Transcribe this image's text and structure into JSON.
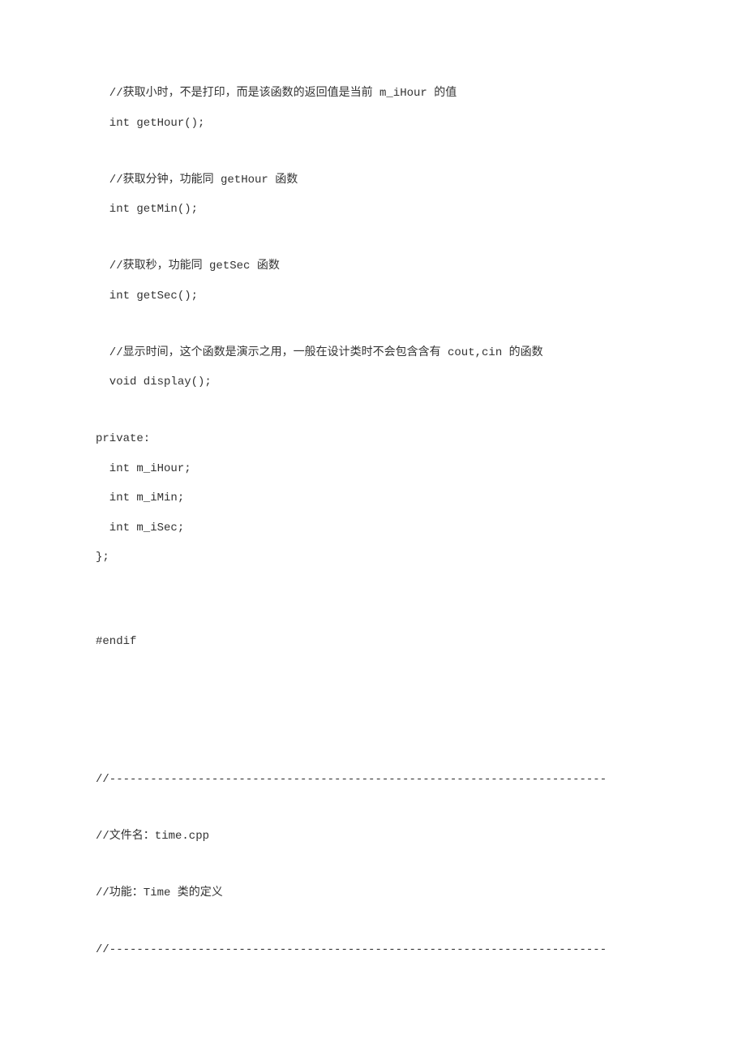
{
  "lines": [
    "  //获取小时，不是打印，而是该函数的返回值是当前 m_iHour 的值",
    "  int getHour();",
    "",
    "  //获取分钟，功能同 getHour 函数",
    "  int getMin();",
    "",
    "  //获取秒，功能同 getSec 函数",
    "  int getSec();",
    "",
    "  //显示时间，这个函数是演示之用，一般在设计类时不会包含含有 cout,cin 的函数",
    "  void display();",
    "",
    "private:",
    "  int m_iHour;",
    "  int m_iMin;",
    "  int m_iSec;",
    "};",
    "",
    "",
    "#endif",
    "",
    "",
    "",
    "",
    "//-------------------------------------------------------------------------",
    "",
    "//文件名：time.cpp",
    "",
    "//功能：Time 类的定义",
    "",
    "//-------------------------------------------------------------------------"
  ]
}
